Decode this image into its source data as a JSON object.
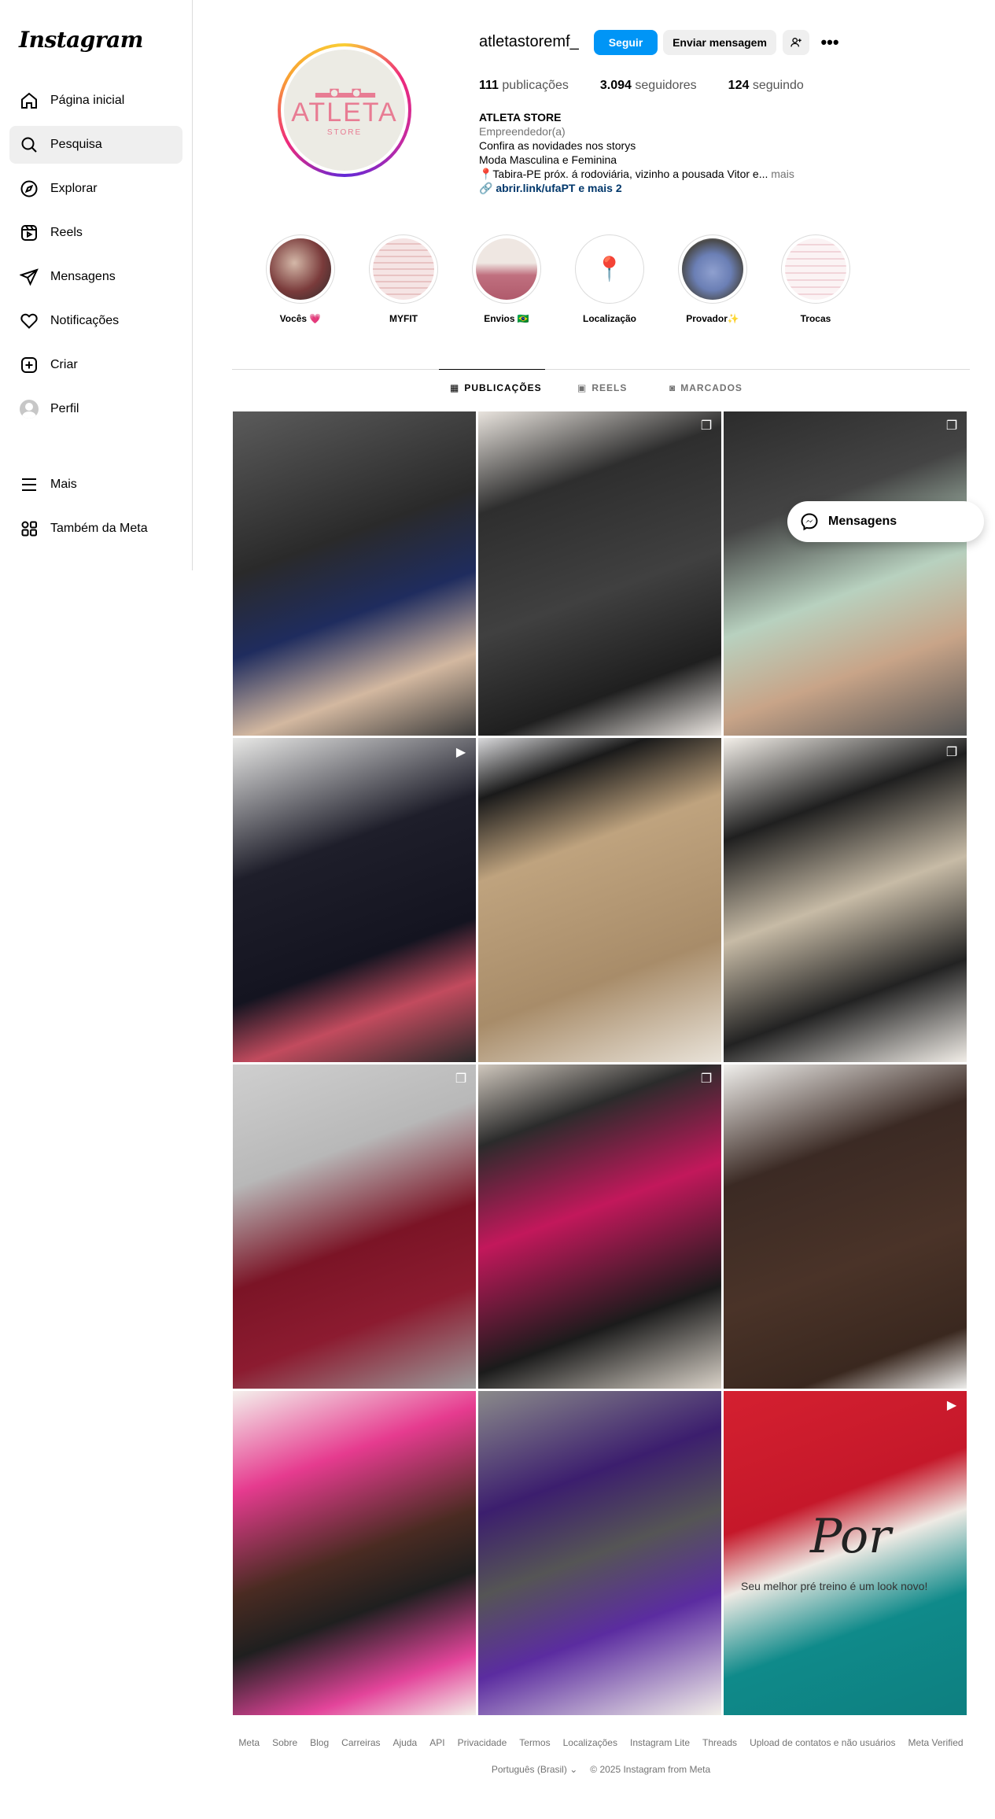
{
  "app": {
    "logo": "Instagram"
  },
  "sidebar": {
    "items": [
      {
        "label": "Página inicial",
        "icon": "home-icon"
      },
      {
        "label": "Pesquisa",
        "icon": "search-icon",
        "active": true
      },
      {
        "label": "Explorar",
        "icon": "compass-icon"
      },
      {
        "label": "Reels",
        "icon": "reels-icon"
      },
      {
        "label": "Mensagens",
        "icon": "messenger-icon"
      },
      {
        "label": "Notificações",
        "icon": "heart-icon"
      },
      {
        "label": "Criar",
        "icon": "plus-square-icon"
      },
      {
        "label": "Perfil",
        "icon": "avatar-icon"
      }
    ],
    "bottom_items": [
      {
        "label": "Mais",
        "icon": "menu-icon"
      },
      {
        "label": "Também da Meta",
        "icon": "meta-apps-icon"
      }
    ]
  },
  "profile": {
    "username": "atletastoremf_",
    "follow_label": "Seguir",
    "message_label": "Enviar mensagem",
    "avatar_text": "ATLETA",
    "avatar_subtext": "STORE",
    "stats": {
      "posts_count": "111",
      "posts_label": "publicações",
      "followers_count": "3.094",
      "followers_label": "seguidores",
      "following_count": "124",
      "following_label": "seguindo"
    },
    "bio": {
      "name": "ATLETA STORE",
      "category": "Empreendedor(a)",
      "line1": "Confira as novidades nos storys",
      "line2": "Moda Masculina e Feminina",
      "line3": "📍Tabira-PE próx. á rodoviária, vizinho a pousada Vitor e...",
      "more": "mais",
      "link": "abrir.link/ufaPT e mais 2"
    }
  },
  "highlights": [
    {
      "label": "Vocês 💗",
      "color": "#7a4a4a"
    },
    {
      "label": "MYFIT",
      "color": "#f2dada"
    },
    {
      "label": "Envios 🇧🇷",
      "color": "#b57a86"
    },
    {
      "label": "Localização",
      "color": "#ffffff"
    },
    {
      "label": "Provador✨",
      "color": "#8a99c2"
    },
    {
      "label": "Trocas",
      "color": "#f6e8ea"
    }
  ],
  "tabs": [
    {
      "label": "PUBLICAÇÕES",
      "icon": "grid-icon",
      "active": true
    },
    {
      "label": "REELS",
      "icon": "reels-icon"
    },
    {
      "label": "MARCADOS",
      "icon": "tagged-icon"
    }
  ],
  "posts": [
    {
      "kind": "photo",
      "bg": "linear-gradient(160deg,#5b5b5b 0%,#2a2a2a 40%,#1f2c5e 60%,#d3b8a0 80%,#3a3a3a 100%)"
    },
    {
      "kind": "photo",
      "bg": "linear-gradient(160deg,#e8e3dd 0%,#2e2e2e 25%,#404040 55%,#1f1f1f 80%,#ece7e2 100%)",
      "badge": "carousel"
    },
    {
      "kind": "photo",
      "bg": "linear-gradient(160deg,#2c2c2c 0%,#444 30%,#b8d1bf 55%,#c8a488 75%,#555 100%)",
      "badge": "carousel"
    },
    {
      "kind": "reel",
      "bg": "linear-gradient(160deg,#e8e8e6 0%,#1e1e2a 35%,#141420 65%,#c24b5e 80%,#2a2a2a 100%)",
      "badge": "reel"
    },
    {
      "kind": "photo",
      "bg": "linear-gradient(160deg,#d9d9db 0%,#1a1a1a 15%,#bfa37e 35%,#a88c69 70%,#e9e3d9 100%)"
    },
    {
      "kind": "photo",
      "bg": "linear-gradient(160deg,#f3efe9 0%,#1f1f1f 25%,#c7bba6 50%,#222 75%,#f2eee8 100%)",
      "badge": "carousel"
    },
    {
      "kind": "photo",
      "bg": "linear-gradient(160deg,#cfcfcf 0%,#b8b8b8 30%,#7b1426 55%,#8c1b30 75%,#9a9a9a 100%)",
      "badge": "carousel"
    },
    {
      "kind": "photo",
      "bg": "linear-gradient(160deg,#cfc7bd 0%,#2b2b2b 20%,#c2185b 45%,#1b1b1b 75%,#d9d2c8 100%)",
      "badge": "carousel"
    },
    {
      "kind": "photo",
      "bg": "linear-gradient(160deg,#f0efec 0%,#3b2a24 30%,#4a3328 60%,#3a281f 85%,#eeeeec 100%)"
    },
    {
      "kind": "photo",
      "bg": "linear-gradient(160deg,#f4f0ec 0%,#e63b8f 25%,#4a2b22 50%,#1f1f1f 65%,#e3449a 85%,#f3efe9 100%)"
    },
    {
      "kind": "photo",
      "bg": "linear-gradient(160deg,#8a8a8a 0%,#3c1e6e 30%,#555 50%,#5b2ca0 70%,#f2efe9 100%)"
    },
    {
      "kind": "reel",
      "bg": "linear-gradient(160deg,#d42030 0%,#c5182a 35%,#eeeae4 50%,#0f8a8a 70%,#0e7f80 100%)",
      "badge": "reel",
      "caption_script": "Por",
      "caption": "Seu melhor pré treino é um look novo!"
    }
  ],
  "messenger_pill": {
    "label": "Mensagens"
  },
  "footer": {
    "links": [
      "Meta",
      "Sobre",
      "Blog",
      "Carreiras",
      "Ajuda",
      "API",
      "Privacidade",
      "Termos",
      "Localizações",
      "Instagram Lite",
      "Threads",
      "Upload de contatos e não usuários",
      "Meta Verified"
    ],
    "language": "Português (Brasil)",
    "copyright": "© 2025 Instagram from Meta"
  }
}
